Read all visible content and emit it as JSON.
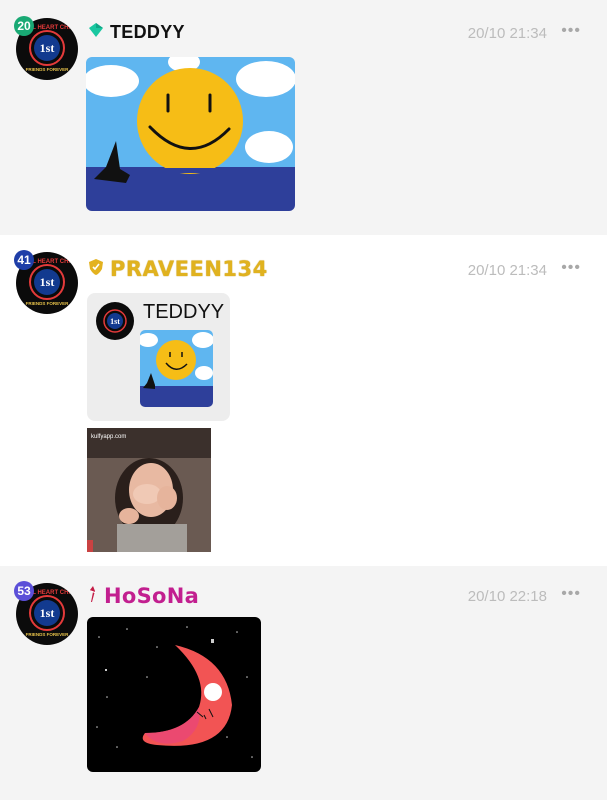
{
  "messages": [
    {
      "level": "20",
      "level_color": "#19a974",
      "username": "TEDDYY",
      "username_color": "#111111",
      "badge_icon": "diamond-icon",
      "time": "20/10 21:34",
      "more": "•••",
      "avatar_text": {
        "top": "TAMIL HEART CHAT",
        "center": "1st",
        "bottom": "FRIENDS FOREVER"
      }
    },
    {
      "level": "41",
      "level_color": "#1f3ea8",
      "username": "PRAVEEN134",
      "username_color": "#e0b21f",
      "badge_icon": "shield-icon",
      "time": "20/10 21:34",
      "more": "•••",
      "quote": {
        "username": "TEDDYY"
      },
      "gif_watermark": "kulfyapp.com",
      "avatar_text": {
        "top": "TAMIL HEART CHAT",
        "center": "1st",
        "bottom": "FRIENDS FOREVER"
      }
    },
    {
      "level": "53",
      "level_color": "#5b4fd8",
      "username": "HoSoNa",
      "username_color": "#c21f8f",
      "badge_icon": "ribbon-icon",
      "time": "20/10 22:18",
      "more": "•••",
      "avatar_text": {
        "top": "TAMIL HEART CHAT",
        "center": "1st",
        "bottom": "FRIENDS FOREVER"
      }
    }
  ]
}
